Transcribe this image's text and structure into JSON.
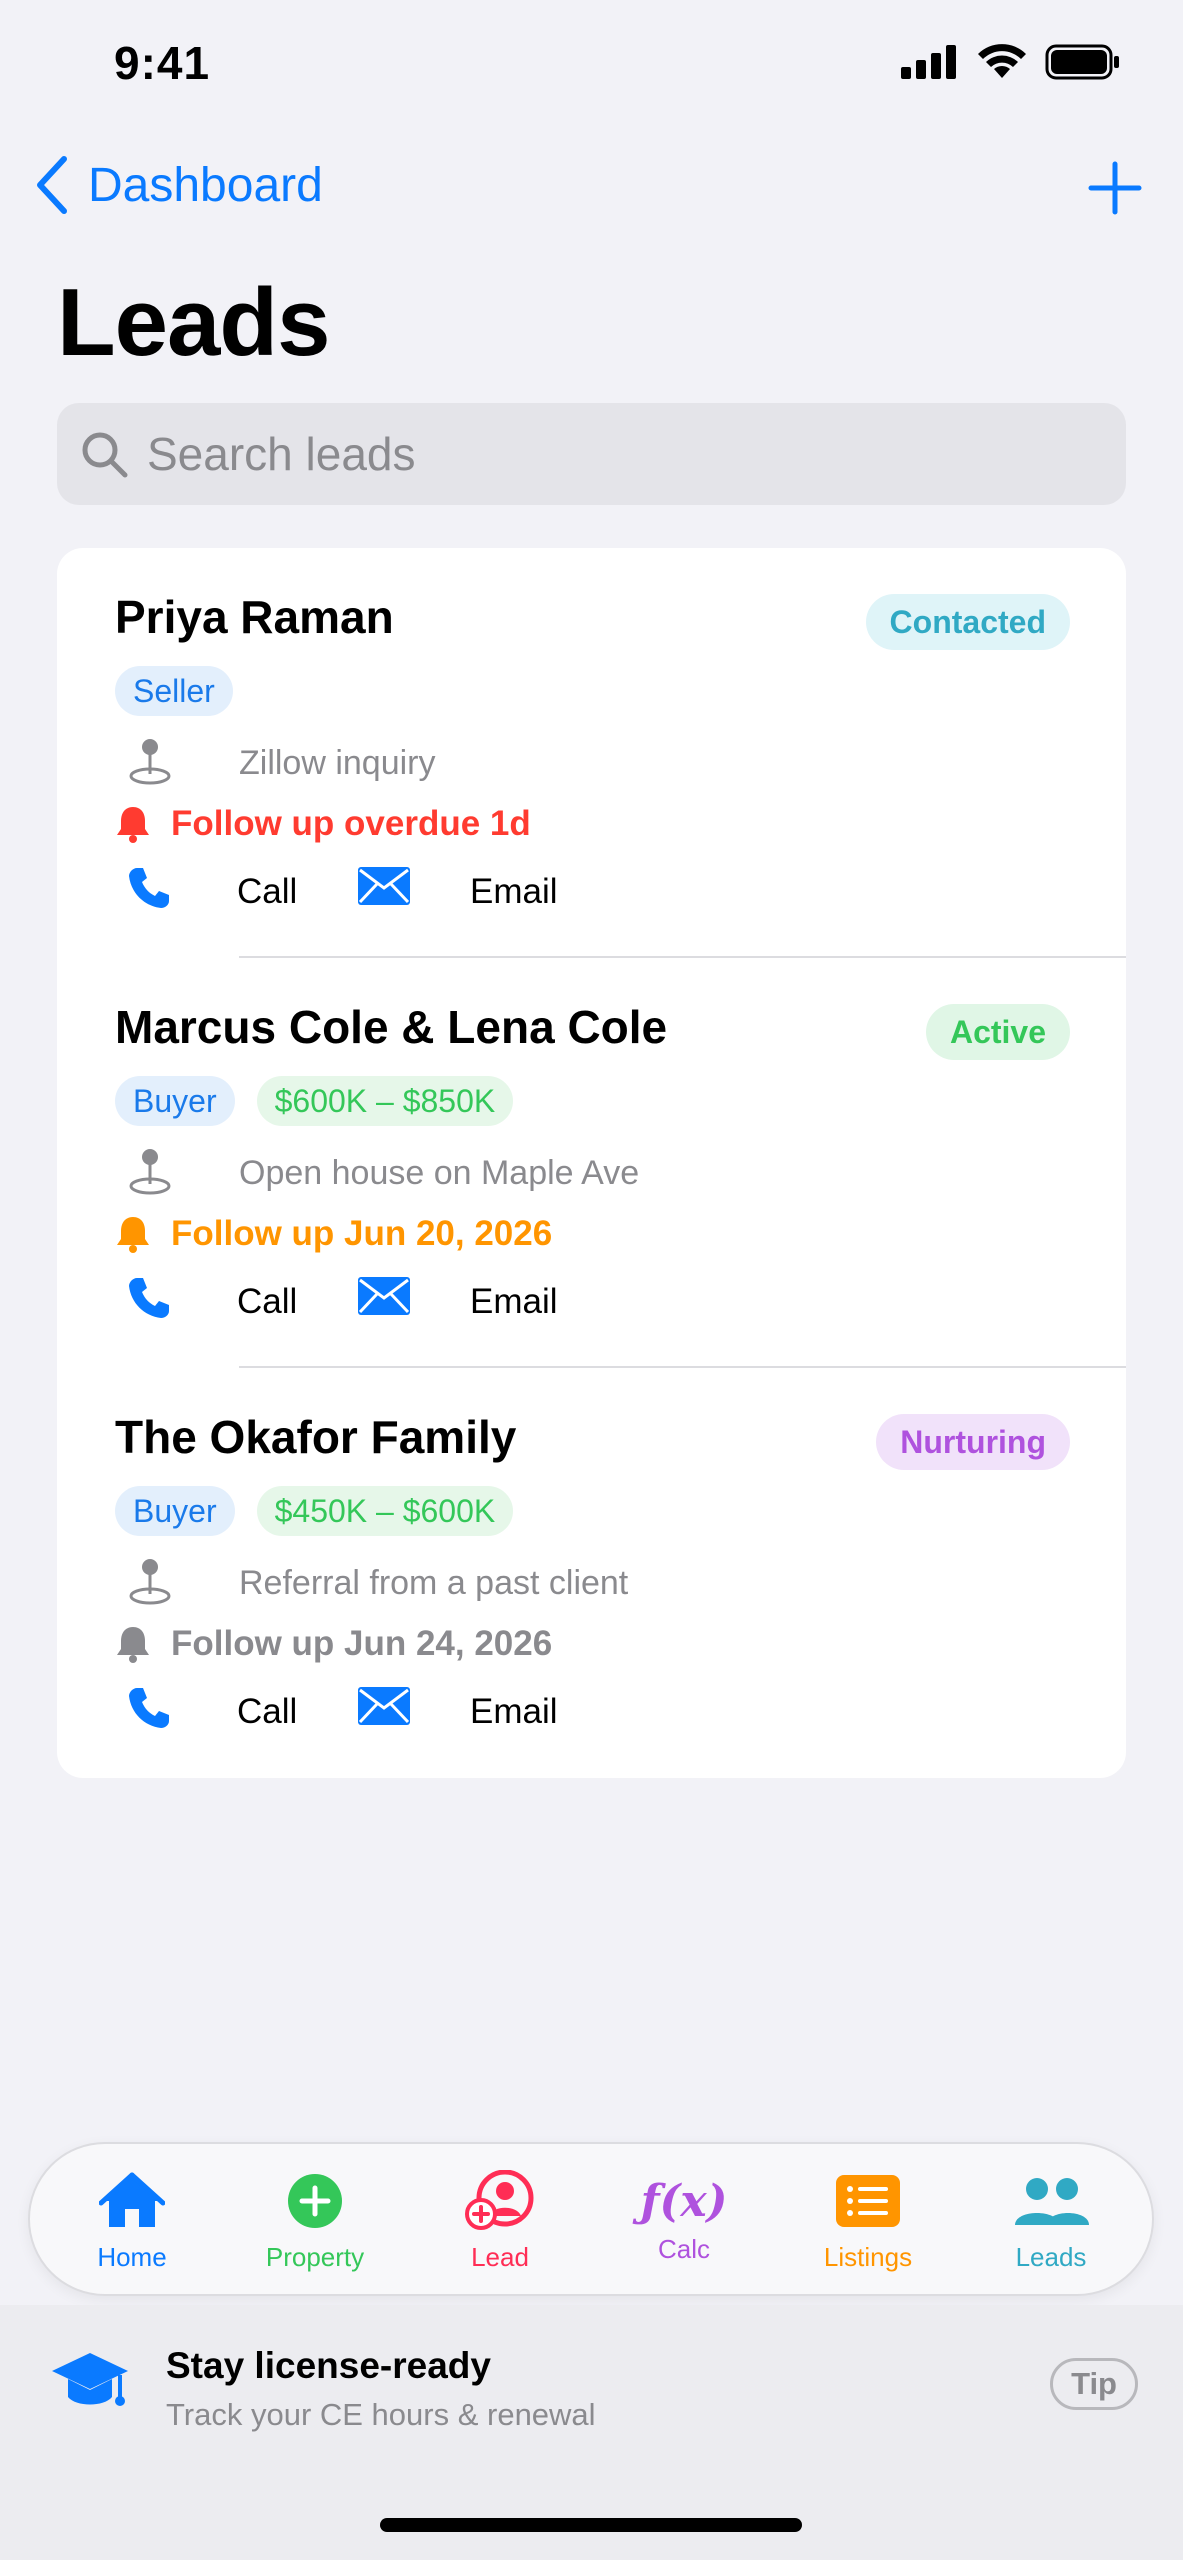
{
  "status_bar": {
    "time": "9:41"
  },
  "nav": {
    "back_label": "Dashboard",
    "title": "Leads"
  },
  "search": {
    "placeholder": "Search leads",
    "value": ""
  },
  "colors": {
    "accent": "#0a7aff",
    "overdue": "#ff3b30",
    "upcoming": "#ff9500",
    "future": "#8a8a8e",
    "contacted_bg": "#dff4f8",
    "contacted_fg": "#30a9c4",
    "active_bg": "#e0f6e6",
    "active_fg": "#34c759",
    "nurturing_bg": "#f1e2fa",
    "nurturing_fg": "#af52de"
  },
  "leads": [
    {
      "name": "Priya Raman",
      "status": "Contacted",
      "type": "Seller",
      "price": "",
      "source": "Zillow inquiry",
      "followup": "Follow up overdue 1d",
      "call_label": "Call",
      "email_label": "Email"
    },
    {
      "name": "Marcus Cole & Lena Cole",
      "status": "Active",
      "type": "Buyer",
      "price": "$600K – $850K",
      "source": "Open house on Maple Ave",
      "followup": "Follow up Jun 20, 2026",
      "call_label": "Call",
      "email_label": "Email"
    },
    {
      "name": "The Okafor Family",
      "status": "Nurturing",
      "type": "Buyer",
      "price": "$450K – $600K",
      "source": "Referral from a past client",
      "followup": "Follow up Jun 24, 2026",
      "call_label": "Call",
      "email_label": "Email"
    }
  ],
  "tabbar": {
    "tabs": [
      {
        "label": "Home",
        "icon": "house-icon",
        "color": "#0a7aff"
      },
      {
        "label": "Property",
        "icon": "plus-circle-icon",
        "color": "#34c759"
      },
      {
        "label": "Lead",
        "icon": "person-add-icon",
        "color": "#ff2d55"
      },
      {
        "label": "Calc",
        "icon": "function-icon",
        "color": "#af52de"
      },
      {
        "label": "Listings",
        "icon": "list-icon",
        "color": "#ff9500"
      },
      {
        "label": "Leads",
        "icon": "people-icon",
        "color": "#30a9c4"
      }
    ]
  },
  "tip": {
    "title": "Stay license-ready",
    "subtitle": "Track your CE hours & renewal",
    "button": "Tip",
    "icon": "graduation-cap-icon"
  }
}
